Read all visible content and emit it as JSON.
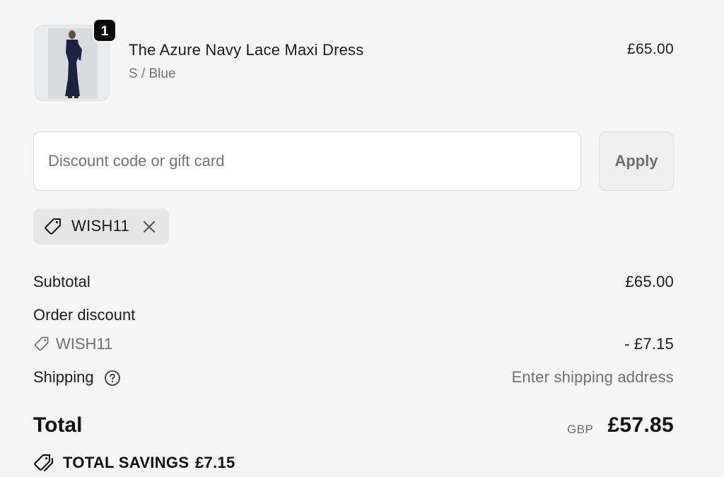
{
  "product": {
    "title": "The Azure Navy Lace Maxi Dress",
    "variant": "S / Blue",
    "price": "£65.00",
    "quantity": "1",
    "image_icon": "dress-thumbnail"
  },
  "discount": {
    "placeholder": "Discount code or gift card",
    "value": "",
    "apply_label": "Apply",
    "applied_code": "WISH11"
  },
  "summary": {
    "subtotal_label": "Subtotal",
    "subtotal_value": "£65.00",
    "order_discount_label": "Order discount",
    "discount_code": "WISH11",
    "discount_amount": "- £7.15",
    "shipping_label": "Shipping",
    "shipping_value": "Enter shipping address",
    "total_label": "Total",
    "total_currency": "GBP",
    "total_amount": "£57.85",
    "savings_label": "TOTAL SAVINGS",
    "savings_amount": "£7.15"
  },
  "colors": {
    "background": "#f5f5f5",
    "badge": "#0b0b0b",
    "chip": "#e6e6e6",
    "muted_text": "#707070"
  }
}
